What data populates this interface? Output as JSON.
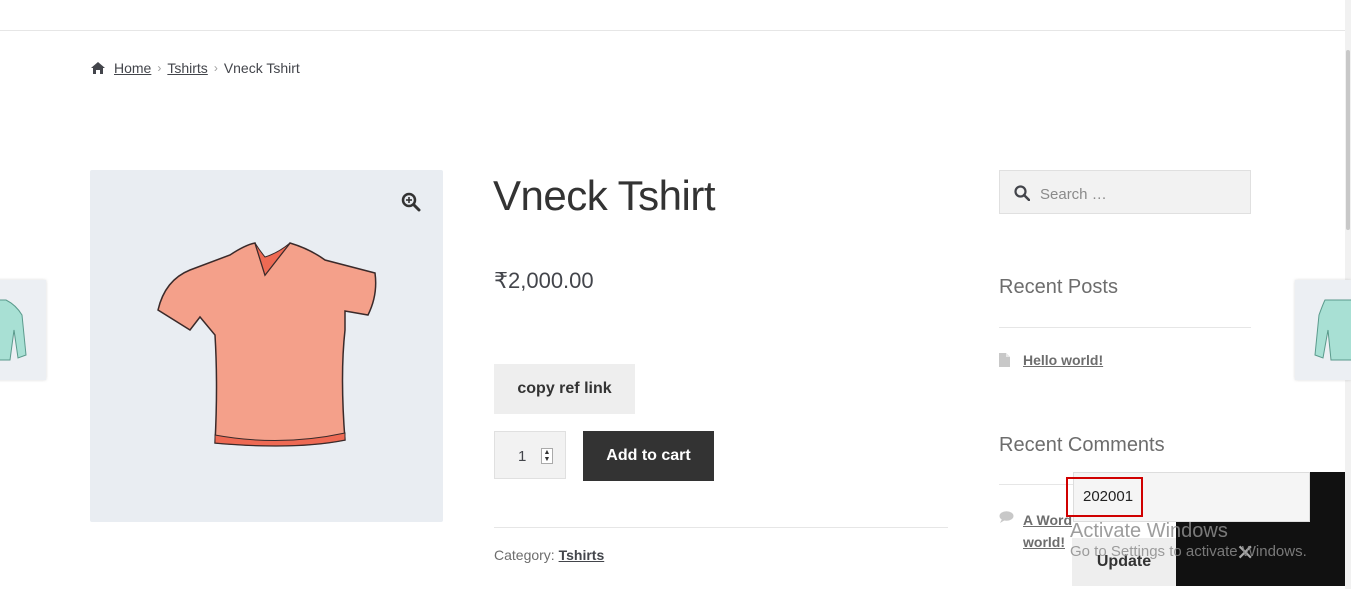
{
  "breadcrumb": {
    "home": "Home",
    "category": "Tshirts",
    "current": "Vneck Tshirt"
  },
  "product": {
    "title": "Vneck Tshirt",
    "price": "₹2,000.00",
    "copy_ref_label": "copy ref link",
    "quantity": "1",
    "add_to_cart_label": "Add to cart",
    "category_label": "Category:",
    "category": "Tshirts"
  },
  "sidebar": {
    "search_placeholder": "Search …",
    "recent_posts_title": "Recent Posts",
    "post": "Hello world!",
    "recent_comments_title": "Recent Comments",
    "comment_link": "A WordPress Commenter on Hello world!",
    "comment_visible": "A Word\nworld!"
  },
  "overlay": {
    "code_value": "202001",
    "update_label": "Update",
    "close_glyph": "✕"
  },
  "watermark": {
    "title": "Activate Windows",
    "subtitle": "Go to Settings to activate Windows."
  },
  "colors": {
    "button_dark": "#333333",
    "button_light": "#eeeeee",
    "image_bg": "#e9edf2",
    "highlight": "#d00000"
  },
  "icons": [
    "home-icon",
    "zoom-icon",
    "search-icon",
    "document-icon",
    "comment-icon",
    "close-icon"
  ]
}
